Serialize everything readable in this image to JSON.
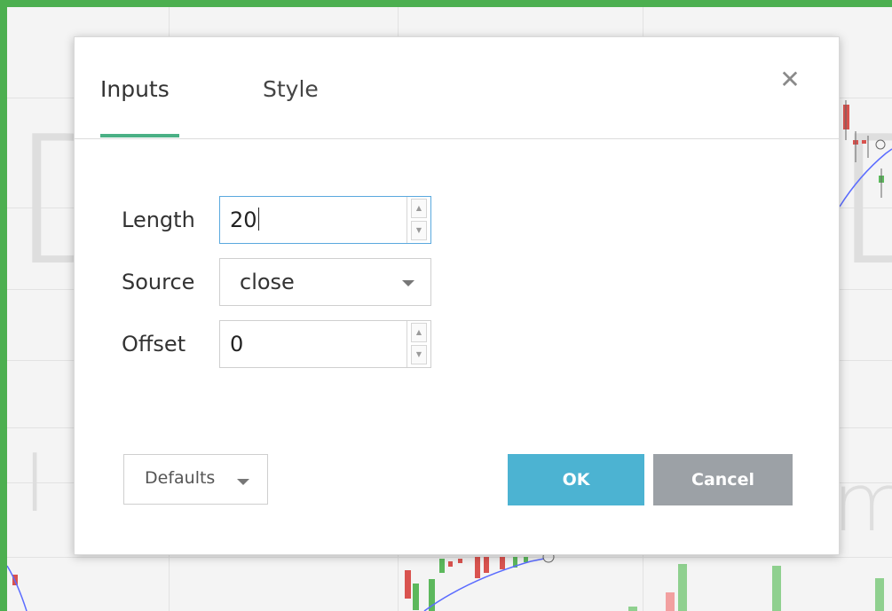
{
  "dialog": {
    "tabs": [
      {
        "label": "Inputs",
        "active": true
      },
      {
        "label": "Style",
        "active": false
      }
    ],
    "close_icon": "close-icon",
    "fields": {
      "length": {
        "label": "Length",
        "value": "20"
      },
      "source": {
        "label": "Source",
        "value": "close"
      },
      "offset": {
        "label": "Offset",
        "value": "0"
      }
    },
    "buttons": {
      "defaults": "Defaults",
      "ok": "OK",
      "cancel": "Cancel"
    }
  },
  "background": {
    "watermark_letters": [
      "D",
      "D",
      "I",
      "m"
    ]
  },
  "colors": {
    "frame": "#4caf50",
    "tab_underline": "#4ab085",
    "ok_button": "#4cb3d2",
    "cancel_button": "#9ca1a6",
    "focus_border": "#5aa9de"
  }
}
